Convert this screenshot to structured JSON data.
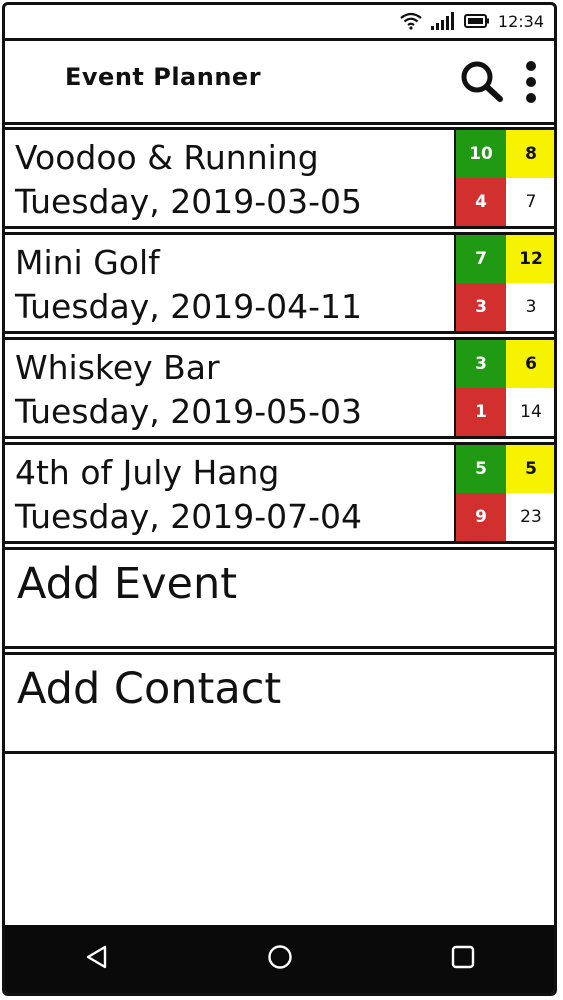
{
  "status_bar": {
    "time": "12:34",
    "icons": [
      "wifi-icon",
      "signal-icon",
      "battery-icon"
    ]
  },
  "app_bar": {
    "title": "Event Planner",
    "icons": [
      "search-icon",
      "overflow-menu-icon"
    ]
  },
  "events": [
    {
      "name": "Voodoo & Running",
      "date": "Tuesday, 2019-03-05",
      "counts": {
        "green": "10",
        "yellow": "8",
        "red": "4",
        "white": "7"
      }
    },
    {
      "name": "Mini Golf",
      "date": "Tuesday, 2019-04-11",
      "counts": {
        "green": "7",
        "yellow": "12",
        "red": "3",
        "white": "3"
      }
    },
    {
      "name": "Whiskey Bar",
      "date": "Tuesday, 2019-05-03",
      "counts": {
        "green": "3",
        "yellow": "6",
        "red": "1",
        "white": "14"
      }
    },
    {
      "name": "4th of July Hang",
      "date": "Tuesday, 2019-07-04",
      "counts": {
        "green": "5",
        "yellow": "5",
        "red": "9",
        "white": "23"
      }
    }
  ],
  "actions": {
    "add_event": "Add Event",
    "add_contact": "Add Contact"
  },
  "nav_bar": {
    "icons": [
      "back-icon",
      "home-icon",
      "recents-icon"
    ]
  },
  "colors": {
    "green": "#1f9a12",
    "yellow": "#f7f300",
    "red": "#d1302f",
    "nav_background": "#0a0a0a"
  }
}
